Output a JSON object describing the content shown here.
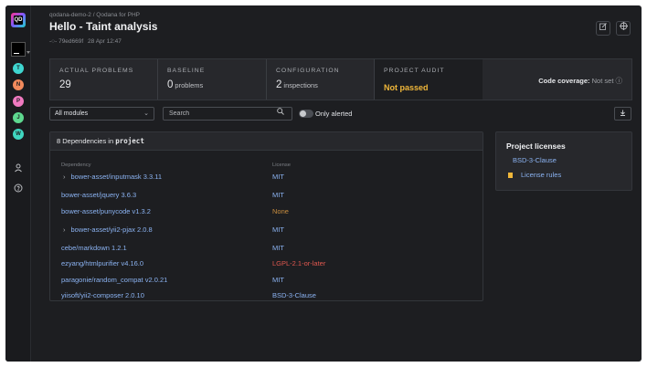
{
  "rail": {
    "logo_text": "QD",
    "avatars": [
      {
        "letter": "T",
        "color": "#3fd6d0"
      },
      {
        "letter": "N",
        "color": "#f28a5c"
      },
      {
        "letter": "P",
        "color": "#f07ac0"
      },
      {
        "letter": "J",
        "color": "#5ed88f"
      },
      {
        "letter": "W",
        "color": "#3fd6c0"
      }
    ],
    "icons": [
      "user-icon",
      "help-icon"
    ]
  },
  "header": {
    "breadcrumb": "qodana-demo-2 / Qodana for PHP",
    "title": "Hello - Taint analysis",
    "commit_hash": "79ed669f",
    "commit_date": "28 Apr 12:47",
    "commit_icon": "commit-icon",
    "buttons": [
      "edit-icon",
      "settings-icon"
    ]
  },
  "stats": {
    "actual_problems": {
      "label": "ACTUAL PROBLEMS",
      "value": "29"
    },
    "baseline": {
      "label": "BASELINE",
      "value": "0",
      "unit": "problems"
    },
    "configuration": {
      "label": "CONFIGURATION",
      "value": "2",
      "unit": "inspections"
    },
    "project_audit": {
      "label": "PROJECT AUDIT",
      "value": "Not passed",
      "color": "#f0b73a"
    },
    "coverage": {
      "label": "Code coverage:",
      "value": "Not set"
    }
  },
  "filters": {
    "module_select": "All modules",
    "search_placeholder": "Search",
    "only_alerted_label": "Only alerted"
  },
  "dependencies": {
    "count_text": "8 Dependencies in",
    "scope": "project",
    "col_dependency": "Dependency",
    "col_license": "License",
    "rows": [
      {
        "name": "bower-asset/inputmask 3.3.11",
        "license": "MIT",
        "expandable": true,
        "status": "ok"
      },
      {
        "name": "bower-asset/jquery 3.6.3",
        "license": "MIT",
        "expandable": false,
        "status": "ok"
      },
      {
        "name": "bower-asset/punycode v1.3.2",
        "license": "None",
        "expandable": false,
        "status": "none"
      },
      {
        "name": "bower-asset/yii2-pjax 2.0.8",
        "license": "MIT",
        "expandable": true,
        "status": "ok"
      },
      {
        "name": "cebe/markdown 1.2.1",
        "license": "MIT",
        "expandable": false,
        "status": "ok"
      },
      {
        "name": "ezyang/htmlpurifier v4.16.0",
        "license": "LGPL-2.1-or-later",
        "expandable": false,
        "status": "bad"
      },
      {
        "name": "paragonie/random_compat v2.0.21",
        "license": "MIT",
        "expandable": false,
        "status": "ok"
      },
      {
        "name": "yiisoft/yii2-composer 2.0.10",
        "license": "BSD-3-Clause",
        "expandable": false,
        "status": "ok"
      }
    ]
  },
  "project_licenses": {
    "title": "Project licenses",
    "items": [
      "BSD-3-Clause"
    ],
    "rules_link": "License rules"
  }
}
